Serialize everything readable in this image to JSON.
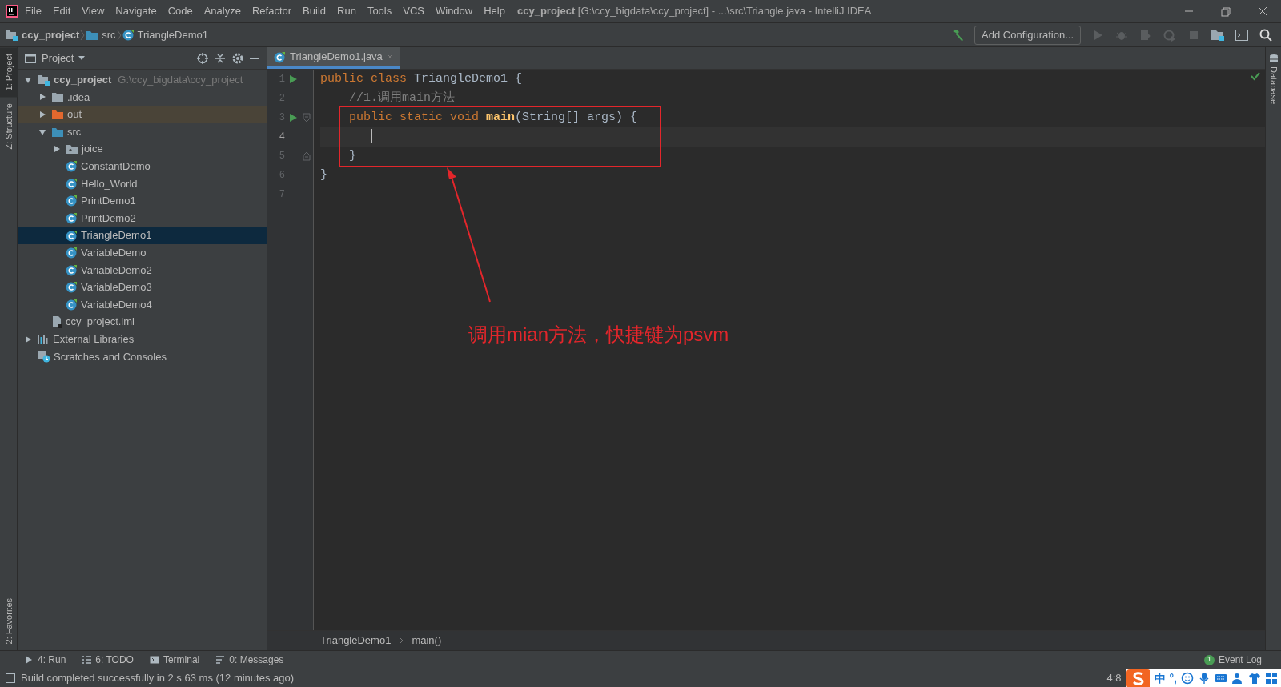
{
  "window": {
    "title": "**ccy_project** [G:\\ccy_bigdata\\ccy_project] - ...\\src\\Triangle.java - IntelliJ IDEA"
  },
  "menu": [
    "File",
    "Edit",
    "View",
    "Navigate",
    "Code",
    "Analyze",
    "Refactor",
    "Build",
    "Run",
    "Tools",
    "VCS",
    "Window",
    "Help"
  ],
  "breadcrumb": [
    {
      "label": "ccy_project",
      "kind": "project"
    },
    {
      "label": "src",
      "kind": "folder"
    },
    {
      "label": "TriangleDemo1",
      "kind": "class"
    }
  ],
  "toolbar": {
    "configuration": "Add Configuration..."
  },
  "left_stripe": [
    {
      "label": "1: Project",
      "selected": true
    },
    {
      "label": "Z: Structure",
      "selected": false
    }
  ],
  "favorites_tab": {
    "label": "2: Favorites"
  },
  "project_panel": {
    "title": "Project",
    "tree": [
      {
        "label": "ccy_project",
        "hint": "G:\\ccy_bigdata\\ccy_project",
        "kind": "project",
        "expanded": true,
        "selected": false,
        "children": [
          {
            "label": ".idea",
            "kind": "folder",
            "expanded": false,
            "selected": false
          },
          {
            "label": "out",
            "kind": "excluded",
            "expanded": false,
            "selected": false
          },
          {
            "label": "src",
            "kind": "source",
            "expanded": true,
            "selected": false,
            "children": [
              {
                "label": "joice",
                "kind": "package",
                "expanded": false,
                "selected": false
              },
              {
                "label": "ConstantDemo",
                "kind": "class",
                "selected": false
              },
              {
                "label": "Hello_World",
                "kind": "class",
                "selected": false
              },
              {
                "label": "PrintDemo1",
                "kind": "class",
                "selected": false
              },
              {
                "label": "PrintDemo2",
                "kind": "class",
                "selected": false
              },
              {
                "label": "TriangleDemo1",
                "kind": "class",
                "selected": true
              },
              {
                "label": "VariableDemo",
                "kind": "class",
                "selected": false
              },
              {
                "label": "VariableDemo2",
                "kind": "class",
                "selected": false
              },
              {
                "label": "VariableDemo3",
                "kind": "class",
                "selected": false
              },
              {
                "label": "VariableDemo4",
                "kind": "class",
                "selected": false
              }
            ]
          },
          {
            "label": "ccy_project.iml",
            "kind": "file",
            "selected": false
          }
        ]
      },
      {
        "label": "External Libraries",
        "kind": "libraries",
        "expanded": false,
        "selected": false
      },
      {
        "label": "Scratches and Consoles",
        "kind": "scratches",
        "selected": false
      }
    ]
  },
  "editor_tabs": [
    {
      "label": "TriangleDemo1.java",
      "selected": true
    }
  ],
  "code": [
    {
      "number": "1",
      "run": true,
      "fold_start": false,
      "fold_end": false,
      "current": false,
      "caret": false,
      "tokens": [
        {
          "text": "public class ",
          "kind": "keyword"
        },
        {
          "text": "TriangleDemo1 {",
          "kind": "plain"
        }
      ]
    },
    {
      "number": "2",
      "run": false,
      "fold_start": false,
      "fold_end": false,
      "current": false,
      "caret": false,
      "tokens": [
        {
          "text": "    //1.调用main方法",
          "kind": "comment"
        }
      ]
    },
    {
      "number": "3",
      "run": true,
      "fold_start": true,
      "fold_end": false,
      "current": false,
      "caret": false,
      "tokens": [
        {
          "text": "    public static void ",
          "kind": "keyword"
        },
        {
          "text": "main",
          "kind": "method"
        },
        {
          "text": "(String[] args) {",
          "kind": "plain"
        }
      ]
    },
    {
      "number": "4",
      "run": false,
      "fold_start": false,
      "fold_end": false,
      "current": true,
      "caret": true
    },
    {
      "number": "5",
      "run": false,
      "fold_start": false,
      "fold_end": true,
      "current": false,
      "caret": false,
      "tokens": [
        {
          "text": "    }",
          "kind": "plain"
        }
      ]
    },
    {
      "number": "6",
      "run": false,
      "fold_start": false,
      "fold_end": false,
      "current": false,
      "caret": false,
      "tokens": [
        {
          "text": "}",
          "kind": "plain"
        }
      ]
    },
    {
      "number": "7",
      "run": false,
      "fold_start": false,
      "fold_end": false,
      "current": false,
      "caret": false
    }
  ],
  "annotation": {
    "text": "调用mian方法，快捷键为psvm"
  },
  "right_stripe": [
    {
      "label": "Database"
    }
  ],
  "editor_breadcrumb": [
    "TriangleDemo1",
    "main()"
  ],
  "tool_windows": [
    {
      "label": "4: Run",
      "kind": "run"
    },
    {
      "label": "6: TODO",
      "kind": "todo"
    },
    {
      "label": "Terminal",
      "kind": "terminal"
    },
    {
      "label": "0: Messages",
      "kind": "messages"
    }
  ],
  "event_log": {
    "count": "1",
    "label": "Event Log"
  },
  "status_bar": {
    "message": "Build completed successfully in 2 s 63 ms (12 minutes ago)",
    "position": "4:8"
  },
  "ime_bar": {
    "mode": "中",
    "punctuation": "°,"
  }
}
